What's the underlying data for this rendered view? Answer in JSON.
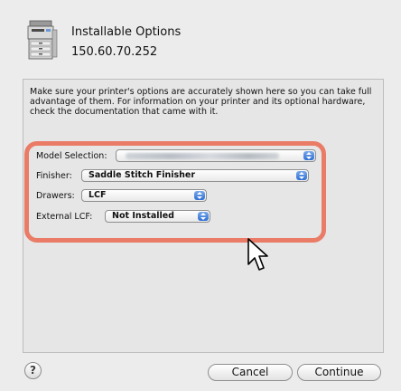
{
  "header": {
    "title": "Installable Options",
    "ip_address": "150.60.70.252",
    "icon": "printer-icon"
  },
  "description": "Make sure your printer's options are accurately shown here so you can take full advantage of them.  For information on your printer and its optional hardware, check the documentation that came with it.",
  "options": {
    "model_selection": {
      "label": "Model Selection:",
      "value": ""
    },
    "finisher": {
      "label": "Finisher:",
      "value": "Saddle Stitch Finisher"
    },
    "drawers": {
      "label": "Drawers:",
      "value": "LCF"
    },
    "external_lcf": {
      "label": "External LCF:",
      "value": "Not Installed"
    }
  },
  "buttons": {
    "help": "?",
    "cancel": "Cancel",
    "continue": "Continue"
  },
  "colors": {
    "highlight": "#ea7b66",
    "popup_arrow": "#2f6fd4",
    "window_bg": "#ececec"
  }
}
